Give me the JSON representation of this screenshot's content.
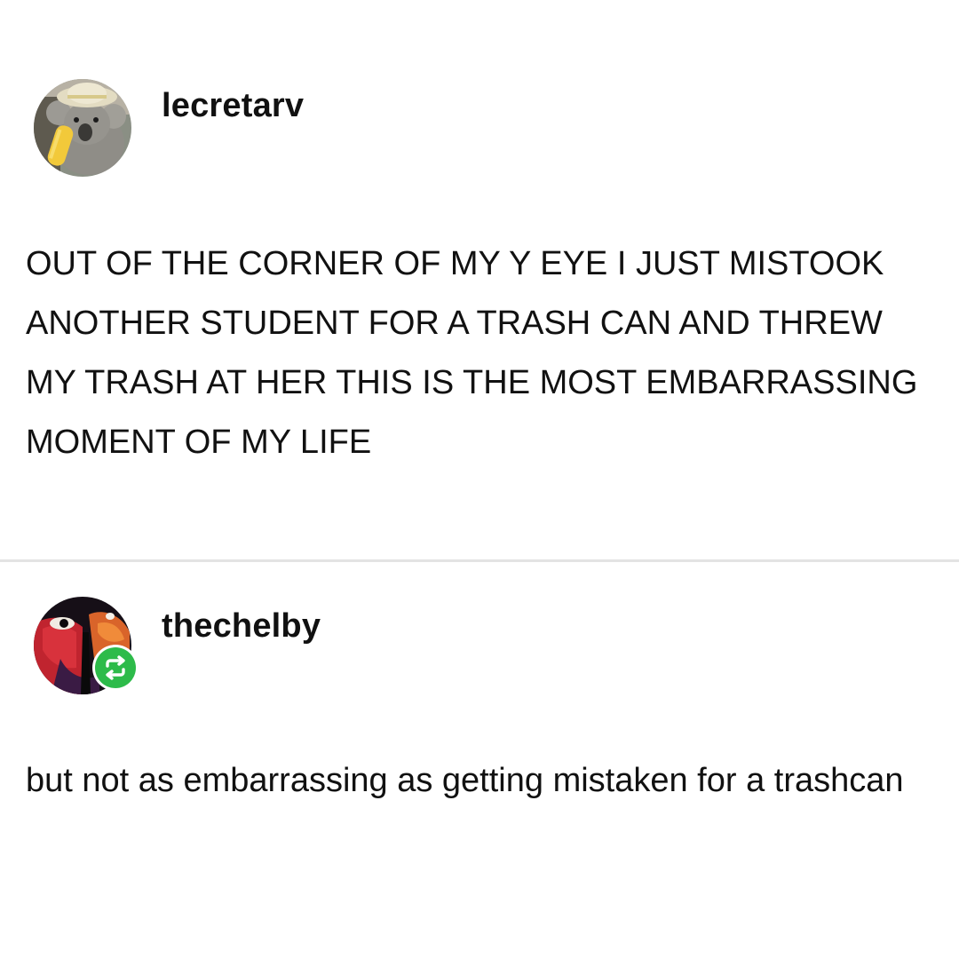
{
  "posts": [
    {
      "username": "lecretarv",
      "avatar_icon": "koala-avatar-icon",
      "body": "OUT OF THE CORNER OF MY Y EYE I JUST MISTOOK ANOTHER STUDENT FOR A TRASH CAN AND THREW MY TRASH AT HER THIS IS THE MOST EMBARRASSING MOMENT OF MY LIFE"
    },
    {
      "username": "thechelby",
      "avatar_icon": "painted-face-avatar-icon",
      "badge_icon": "reblog-icon",
      "badge_color": "#2dbb4a",
      "body": "but not as embarrassing as getting mistaken for a trashcan"
    }
  ]
}
